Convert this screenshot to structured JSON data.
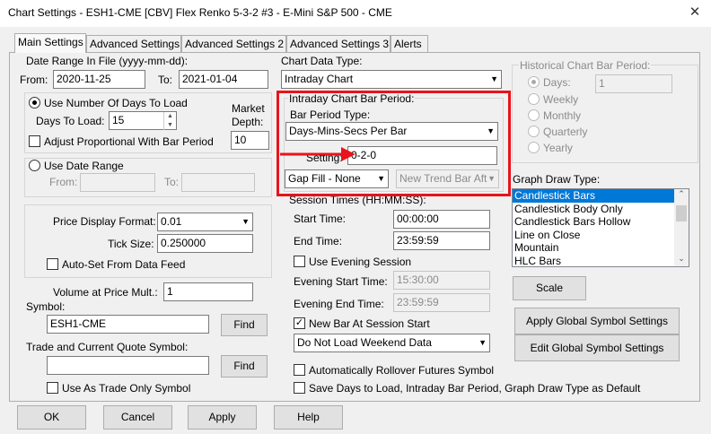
{
  "window": {
    "title": "Chart Settings - ESH1-CME [CBV]  Flex Renko 5-3-2  #3 - E-Mini S&P 500 - CME",
    "close_glyph": "✕"
  },
  "tabs": [
    "Main Settings",
    "Advanced Settings",
    "Advanced Settings 2",
    "Advanced Settings 3",
    "Alerts"
  ],
  "date_range": {
    "label": "Date Range In File (yyyy-mm-dd):",
    "from_label": "From:",
    "from_value": "2020-11-25",
    "to_label": "To:",
    "to_value": "2021-01-04"
  },
  "days_mode": {
    "use_days_label": "Use Number Of Days To Load",
    "days_to_load_label": "Days To Load:",
    "days_to_load_value": "15",
    "adjust_label": "Adjust Proportional With Bar Period",
    "market_depth_label_1": "Market",
    "market_depth_label_2": "Depth:",
    "market_depth_value": "10"
  },
  "date_range_mode": {
    "label": "Use Date Range",
    "from_label": "From:",
    "to_label": "To:"
  },
  "price": {
    "format_label": "Price Display Format:",
    "format_value": "0.01",
    "tick_size_label": "Tick Size:",
    "tick_size_value": "0.250000",
    "autoset_label": "Auto-Set From Data Feed"
  },
  "volume": {
    "label": "Volume at Price Mult.:",
    "value": "1"
  },
  "symbol": {
    "label": "Symbol:",
    "value": "ESH1-CME",
    "find_label": "Find"
  },
  "trade_symbol": {
    "label": "Trade and Current Quote Symbol:",
    "value": "",
    "find_label": "Find",
    "trade_only_label": "Use As Trade Only Symbol"
  },
  "chart_data_type": {
    "label": "Chart Data Type:",
    "value": "Intraday Chart"
  },
  "intraday": {
    "group_label": "Intraday Chart Bar Period:",
    "bar_period_type_label": "Bar Period Type:",
    "bar_period_type_value": "Days-Mins-Secs Per Bar",
    "setting_label": "Setting:",
    "setting_value": "0-2-0",
    "gap_fill_value": "Gap Fill - None",
    "new_trend_value": "New Trend Bar Aft"
  },
  "session": {
    "label": "Session Times (HH:MM:SS):",
    "start_label": "Start Time:",
    "start_value": "00:00:00",
    "end_label": "End Time:",
    "end_value": "23:59:59",
    "use_evening_label": "Use Evening Session",
    "evening_start_label": "Evening Start Time:",
    "evening_start_value": "15:30:00",
    "evening_end_label": "Evening End Time:",
    "evening_end_value": "23:59:59",
    "new_bar_label": "New Bar At Session Start",
    "weekend_value": "Do Not Load Weekend Data"
  },
  "historical": {
    "label": "Historical Chart Bar Period:",
    "options": [
      "Days:",
      "Weekly",
      "Monthly",
      "Quarterly",
      "Yearly"
    ],
    "days_value": "1"
  },
  "graph_draw": {
    "label": "Graph Draw Type:",
    "items": [
      "Candlestick Bars",
      "Candlestick Body Only",
      "Candlestick Bars Hollow",
      "Line on Close",
      "Mountain",
      "HLC Bars"
    ],
    "selected_index": 0
  },
  "buttons": {
    "scale": "Scale",
    "apply_global": "Apply Global Symbol Settings",
    "edit_global": "Edit Global Symbol Settings",
    "ok": "OK",
    "cancel": "Cancel",
    "apply": "Apply",
    "help": "Help"
  },
  "bottom_checks": {
    "auto_rollover": "Automatically Rollover Futures Symbol",
    "save_defaults": "Save Days to Load, Intraday Bar Period, Graph Draw Type as Default"
  },
  "annotation": {
    "color": "#e8141b"
  }
}
